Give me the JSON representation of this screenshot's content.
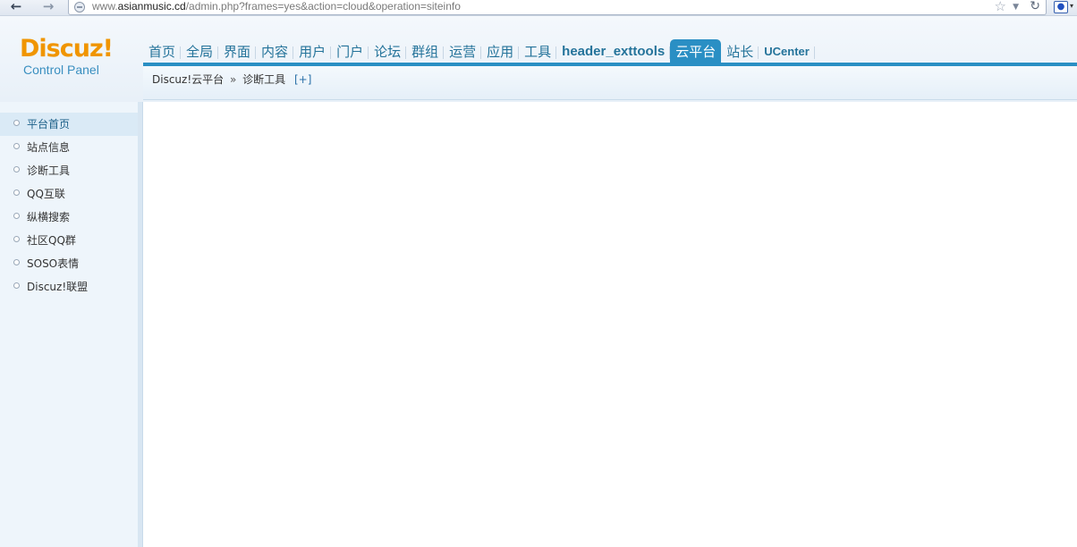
{
  "browser": {
    "url_prefix": "www.",
    "url_domain": "asianmusic.cd",
    "url_path": "/admin.php?frames=yes&action=cloud&operation=siteinfo",
    "back_glyph": "🡐",
    "forward_glyph": "🡒",
    "star_glyph": "☆",
    "drop_glyph": "▼",
    "reload_glyph": "C",
    "ext_glyph": "🐾",
    "ext_arrow_glyph": "▾"
  },
  "logo": {
    "main": "Discuz!",
    "sub": "Control Panel"
  },
  "menu": [
    {
      "label": "首页"
    },
    {
      "label": "全局"
    },
    {
      "label": "界面"
    },
    {
      "label": "内容"
    },
    {
      "label": "用户"
    },
    {
      "label": "门户"
    },
    {
      "label": "论坛"
    },
    {
      "label": "群组"
    },
    {
      "label": "运营"
    },
    {
      "label": "应用"
    },
    {
      "label": "工具"
    },
    {
      "label": "header_exttools"
    },
    {
      "label": "云平台",
      "active": true
    },
    {
      "label": "站长"
    },
    {
      "label": "UCenter"
    }
  ],
  "breadcrumb": {
    "root": "Discuz!云平台",
    "separator": "»",
    "current": "诊断工具",
    "add": "[+]"
  },
  "sidebar": {
    "items": [
      {
        "label": "平台首页",
        "active": true
      },
      {
        "label": "站点信息"
      },
      {
        "label": "诊断工具"
      },
      {
        "label": "QQ互联"
      },
      {
        "label": "纵横搜索"
      },
      {
        "label": "社区QQ群"
      },
      {
        "label": "SOSO表情"
      },
      {
        "label": "Discuz!联盟"
      }
    ]
  },
  "colors": {
    "accent": "#2a8fc4",
    "logo_orange": "#f09500",
    "menu_text": "#24739a"
  }
}
